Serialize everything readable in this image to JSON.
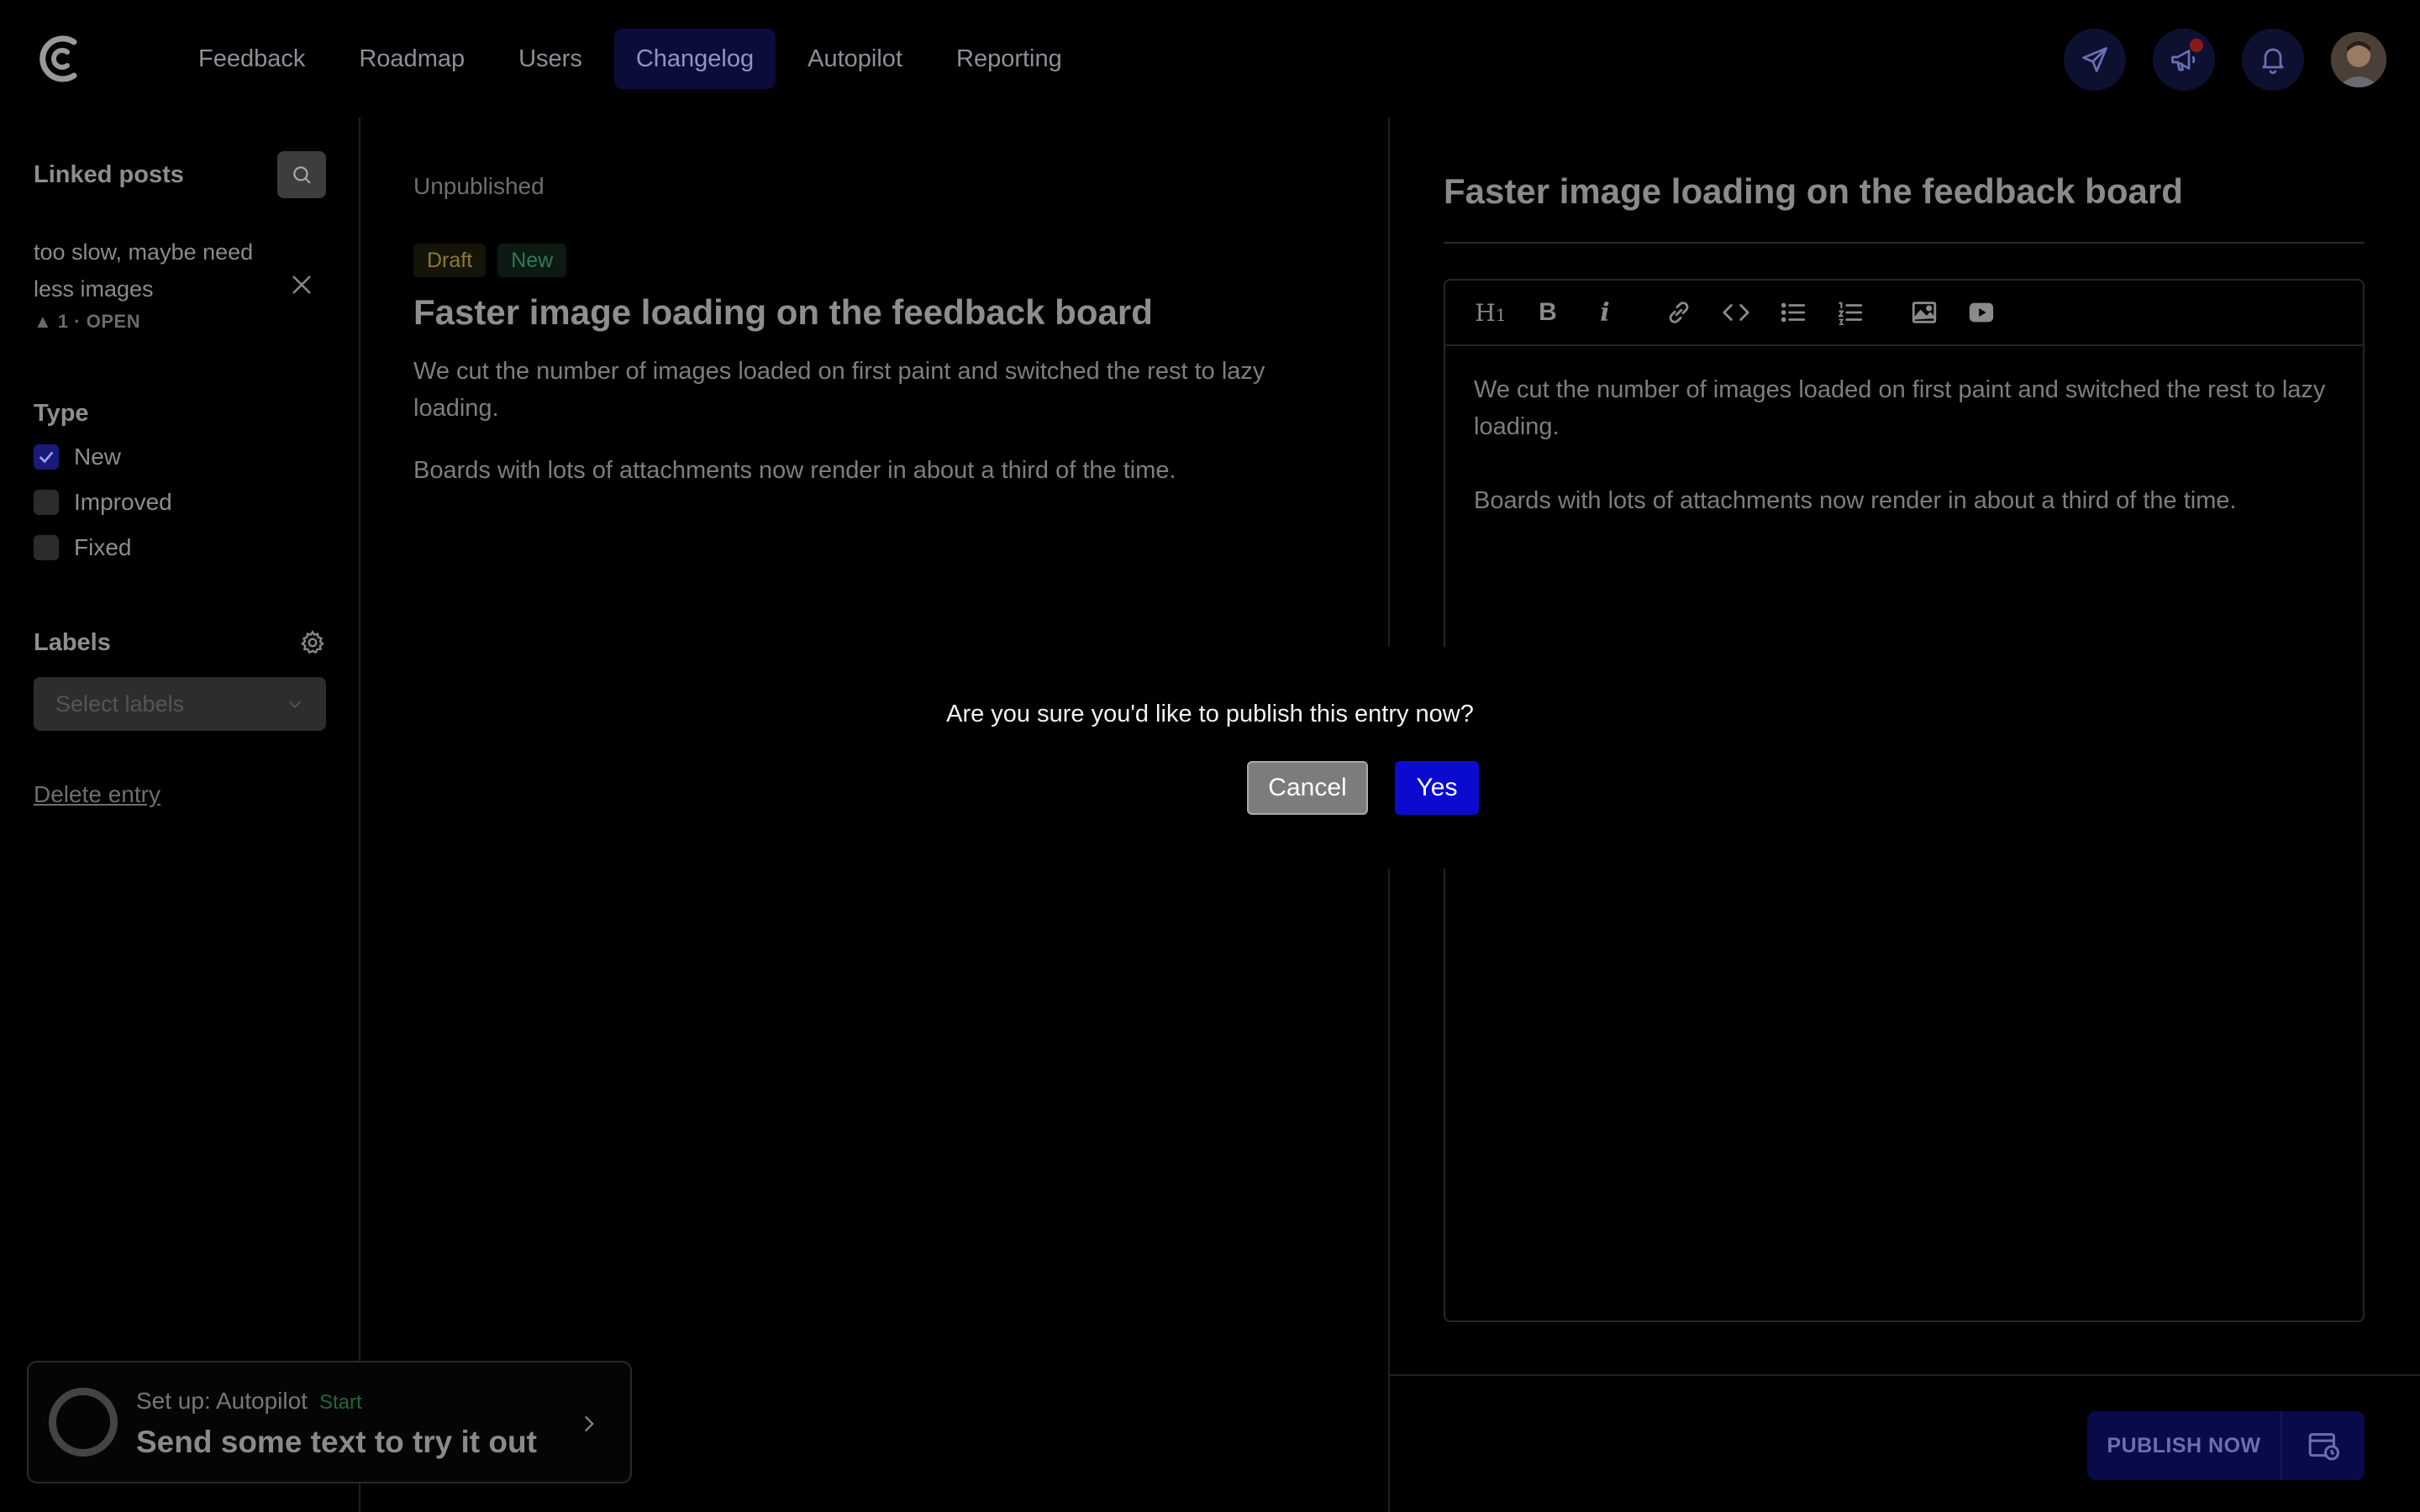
{
  "nav": {
    "items": [
      {
        "label": "Feedback",
        "active": false
      },
      {
        "label": "Roadmap",
        "active": false
      },
      {
        "label": "Users",
        "active": false
      },
      {
        "label": "Changelog",
        "active": true
      },
      {
        "label": "Autopilot",
        "active": false
      },
      {
        "label": "Reporting",
        "active": false
      }
    ],
    "icons": [
      "send-icon",
      "megaphone-icon",
      "bell-icon",
      "avatar"
    ]
  },
  "sidebar": {
    "linked_posts_title": "Linked posts",
    "post": {
      "text": "too slow, maybe need less images",
      "votes": "1",
      "status": "OPEN"
    },
    "type_title": "Type",
    "types": [
      {
        "label": "New",
        "checked": true
      },
      {
        "label": "Improved",
        "checked": false
      },
      {
        "label": "Fixed",
        "checked": false
      }
    ],
    "labels_title": "Labels",
    "labels_placeholder": "Select labels",
    "delete_label": "Delete entry"
  },
  "autopilot": {
    "setup": "Set up: Autopilot",
    "start": "Start",
    "cta": "Send some text to try it out"
  },
  "preview": {
    "status": "Unpublished",
    "badges": [
      "Draft",
      "New"
    ],
    "title": "Faster image loading on the feedback board",
    "paragraphs": [
      "We cut the number of images loaded on first paint and switched the rest to lazy loading.",
      "Boards with lots of attachments now render in about a third of the time."
    ]
  },
  "editor": {
    "title": "Faster image loading on the feedback board",
    "toolbar": [
      "heading-icon",
      "bold-icon",
      "italic-icon",
      "link-icon",
      "code-icon",
      "bullet-list-icon",
      "numbered-list-icon",
      "image-icon",
      "video-icon"
    ],
    "paragraphs": [
      "We cut the number of images loaded on first paint and switched the rest to lazy loading.",
      "Boards with lots of attachments now render in about a third of the time."
    ]
  },
  "publish": {
    "label": "PUBLISH NOW"
  },
  "modal": {
    "question": "Are you sure you'd like to publish this entry now?",
    "cancel": "Cancel",
    "yes": "Yes"
  },
  "colors": {
    "accent": "#0b0bd0",
    "nav_active": "#0c0c3a"
  }
}
